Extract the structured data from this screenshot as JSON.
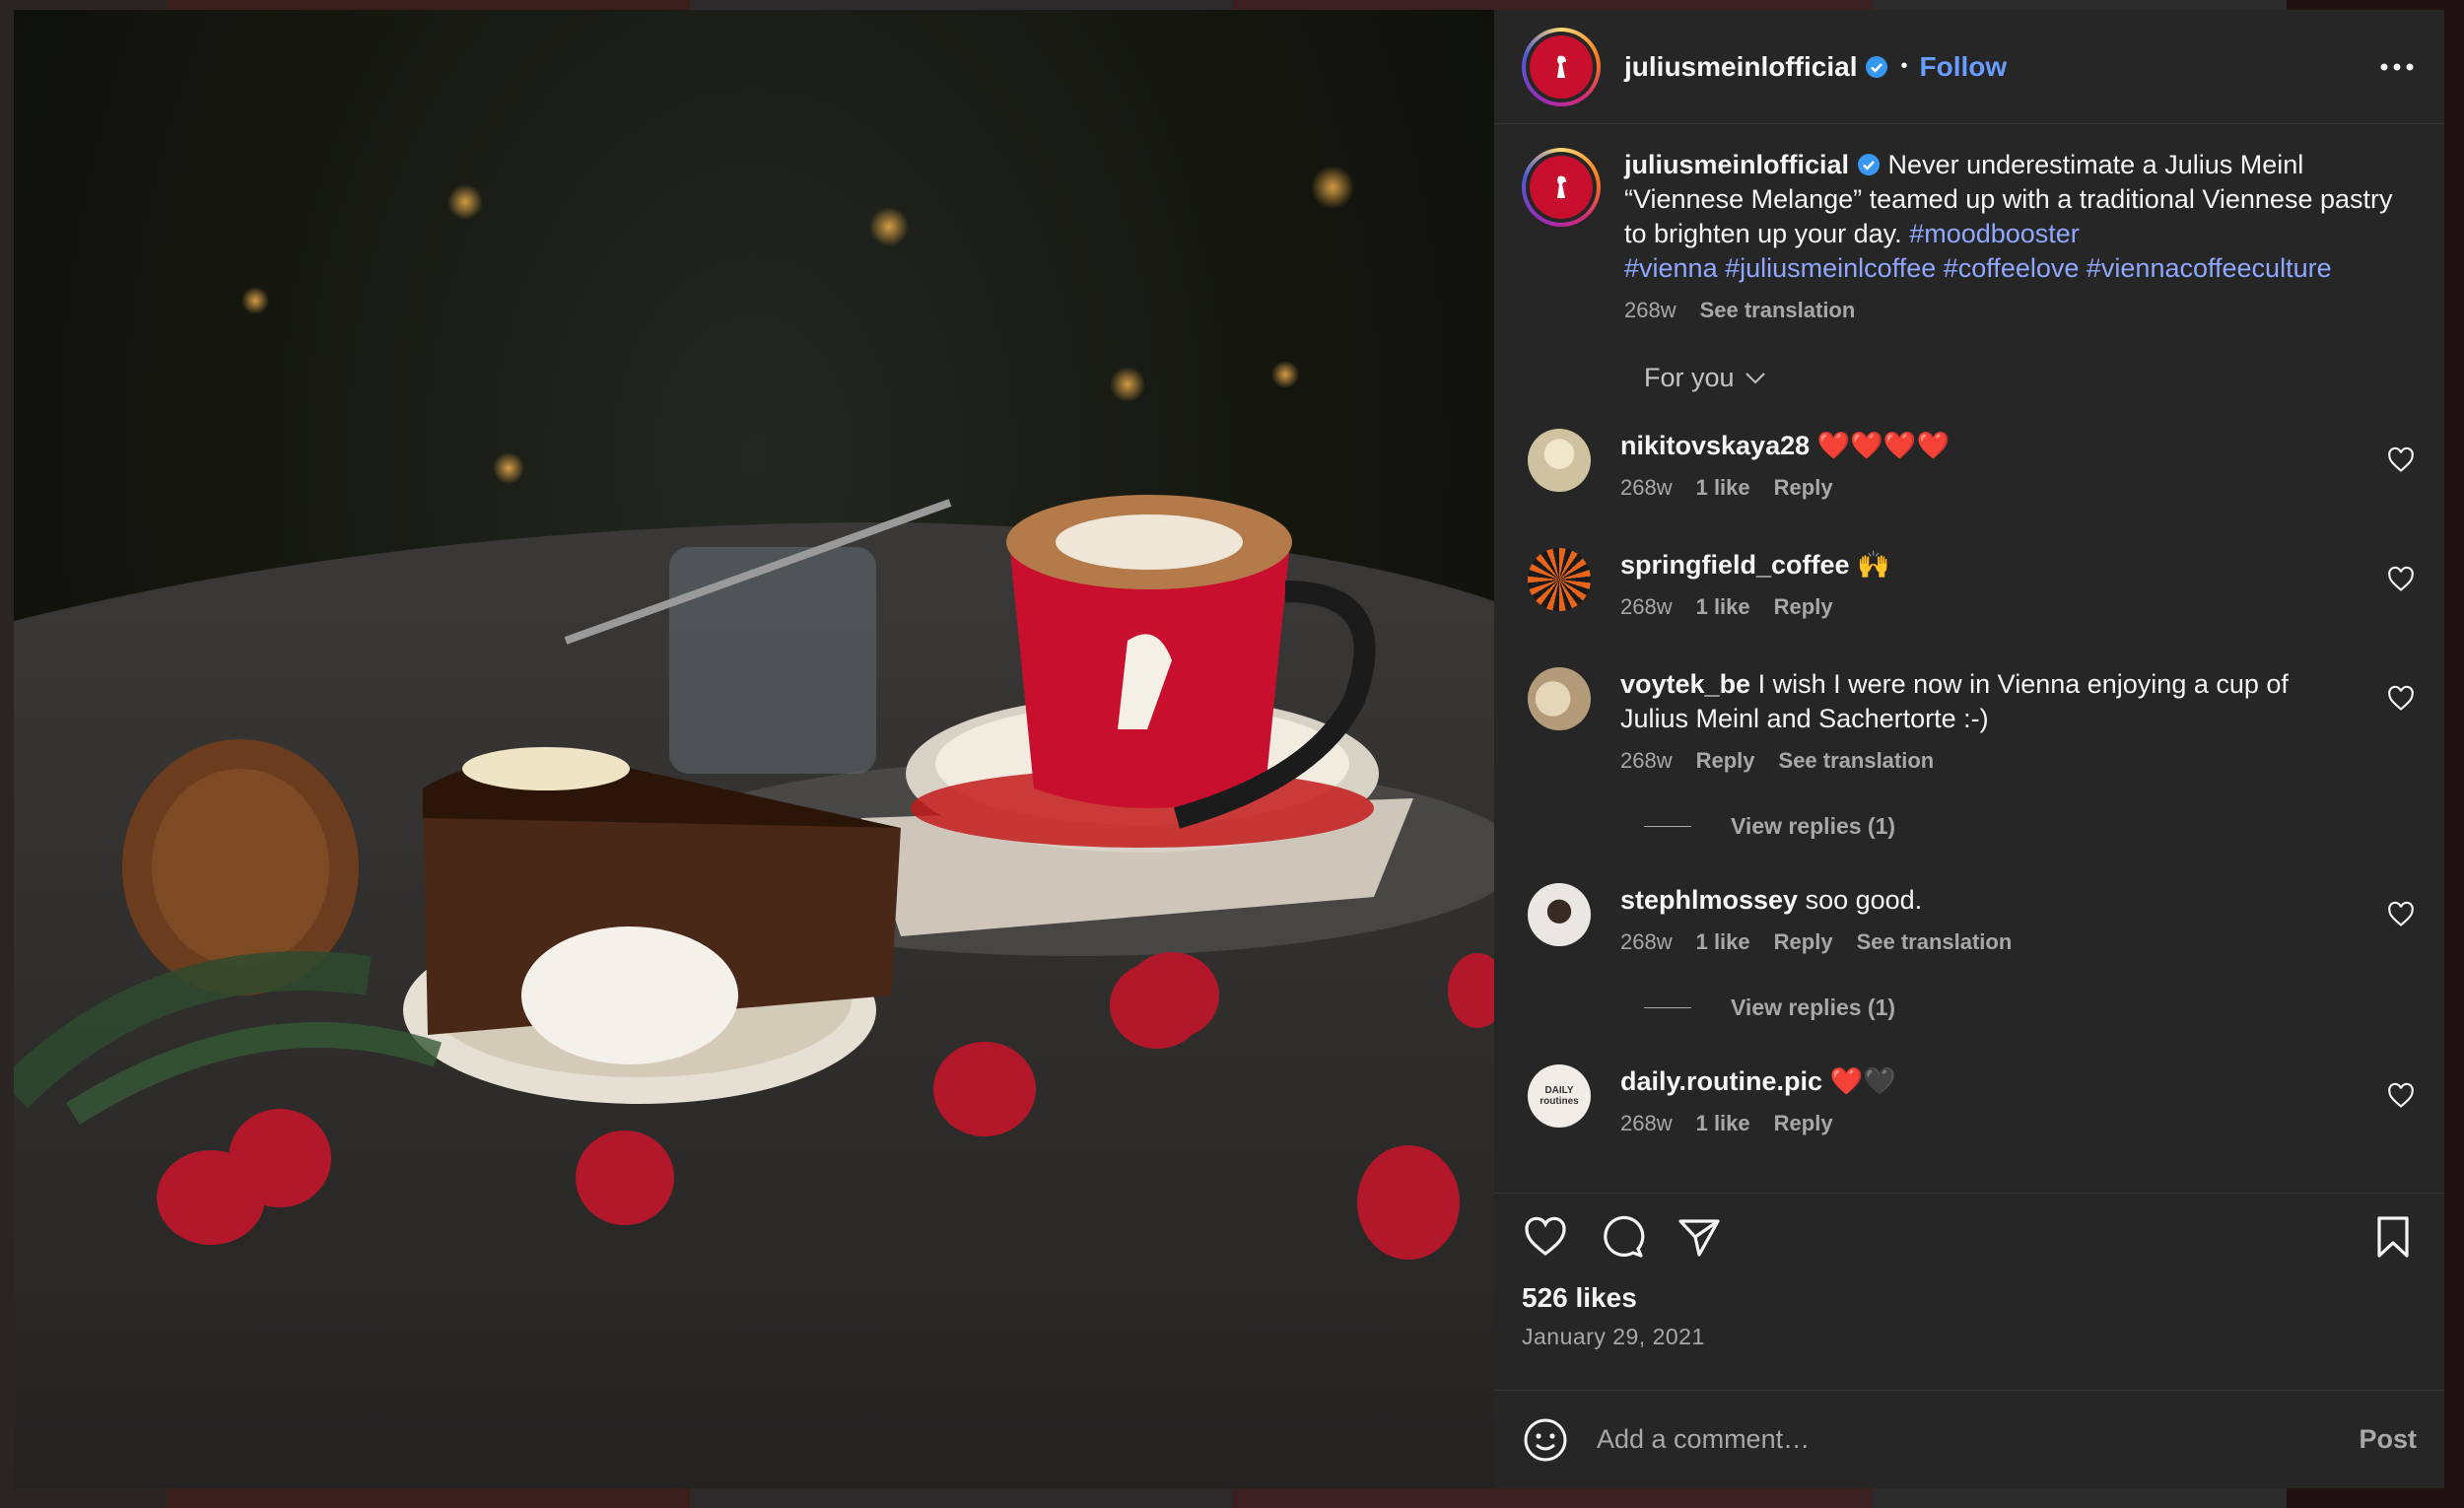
{
  "colors": {
    "accent": "#699cff",
    "hashtag": "#8fa7ff",
    "brand_red": "#c8102e",
    "panel_bg": "#262626"
  },
  "header": {
    "username": "juliusmeinlofficial",
    "dot": "•",
    "follow_label": "Follow"
  },
  "caption": {
    "username": "juliusmeinlofficial",
    "text": " Never underestimate a Julius Meinl “Viennese Melange” teamed up with a traditional Viennese pastry to brighten up your day. ",
    "hashtags": [
      "#moodbooster",
      "#vienna",
      "#juliusmeinlcoffee",
      "#coffeelove",
      "#viennacoffeeculture"
    ],
    "time": "268w",
    "see_translation": "See translation"
  },
  "for_you_label": "For you",
  "comments": [
    {
      "username": "nikitovskaya28",
      "text": " ❤️❤️❤️❤️",
      "time": "268w",
      "likes": "1 like",
      "reply": "Reply"
    },
    {
      "username": "springfield_coffee",
      "text": " 🙌",
      "time": "268w",
      "likes": "1 like",
      "reply": "Reply"
    },
    {
      "username": "voytek_be",
      "text": " I wish I were now in Vienna enjoying a cup of Julius Meinl and Sachertorte :-)",
      "time": "268w",
      "reply": "Reply",
      "see_translation": "See translation",
      "view_replies": "View replies (1)"
    },
    {
      "username": "stephlmossey",
      "text": " soo good.",
      "time": "268w",
      "likes": "1 like",
      "reply": "Reply",
      "see_translation": "See translation",
      "view_replies": "View replies (1)"
    },
    {
      "username": "daily.routine.pic",
      "text": " ❤️🖤",
      "time": "268w",
      "likes": "1 like",
      "reply": "Reply",
      "avatar_text": "DAILY routines"
    }
  ],
  "footer": {
    "likes": "526 likes",
    "date": "January 29, 2021",
    "comment_placeholder": "Add a comment…",
    "post_label": "Post"
  }
}
